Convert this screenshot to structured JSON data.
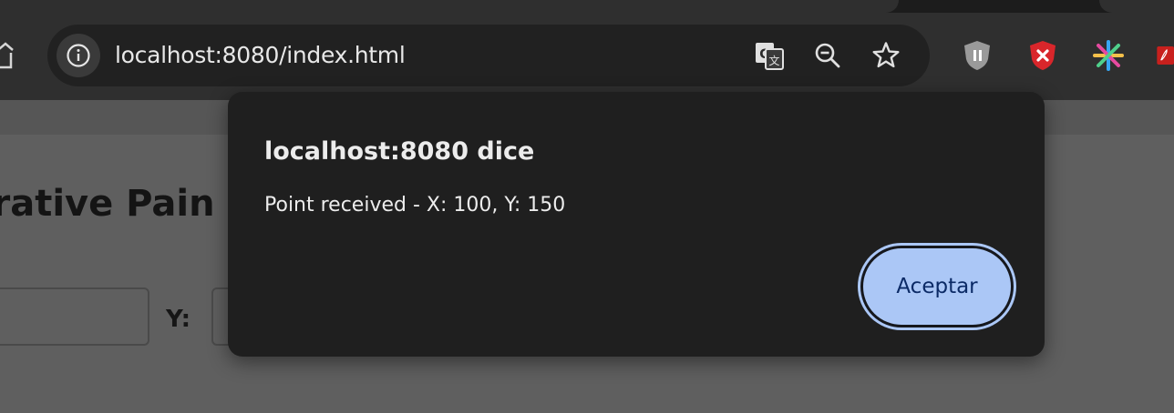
{
  "browser": {
    "url": "localhost:8080/index.html",
    "icons": {
      "home": "home-icon",
      "info": "info-icon",
      "translate": "translate-icon",
      "zoom": "zoom-out-icon",
      "bookmark": "star-icon"
    },
    "extensions": [
      "shield-pause-icon",
      "shield-block-icon",
      "sparkle-icon",
      "pdf-icon"
    ]
  },
  "page": {
    "title": "orative Pain",
    "y_label": "Y:"
  },
  "dialog": {
    "title": "localhost:8080 dice",
    "message": "Point received - X: 100, Y: 150",
    "accept_label": "Aceptar"
  },
  "colors": {
    "accent_button": "#abc7f6",
    "accent_text": "#0b2a66",
    "dialog_bg": "#1f1f1f"
  }
}
